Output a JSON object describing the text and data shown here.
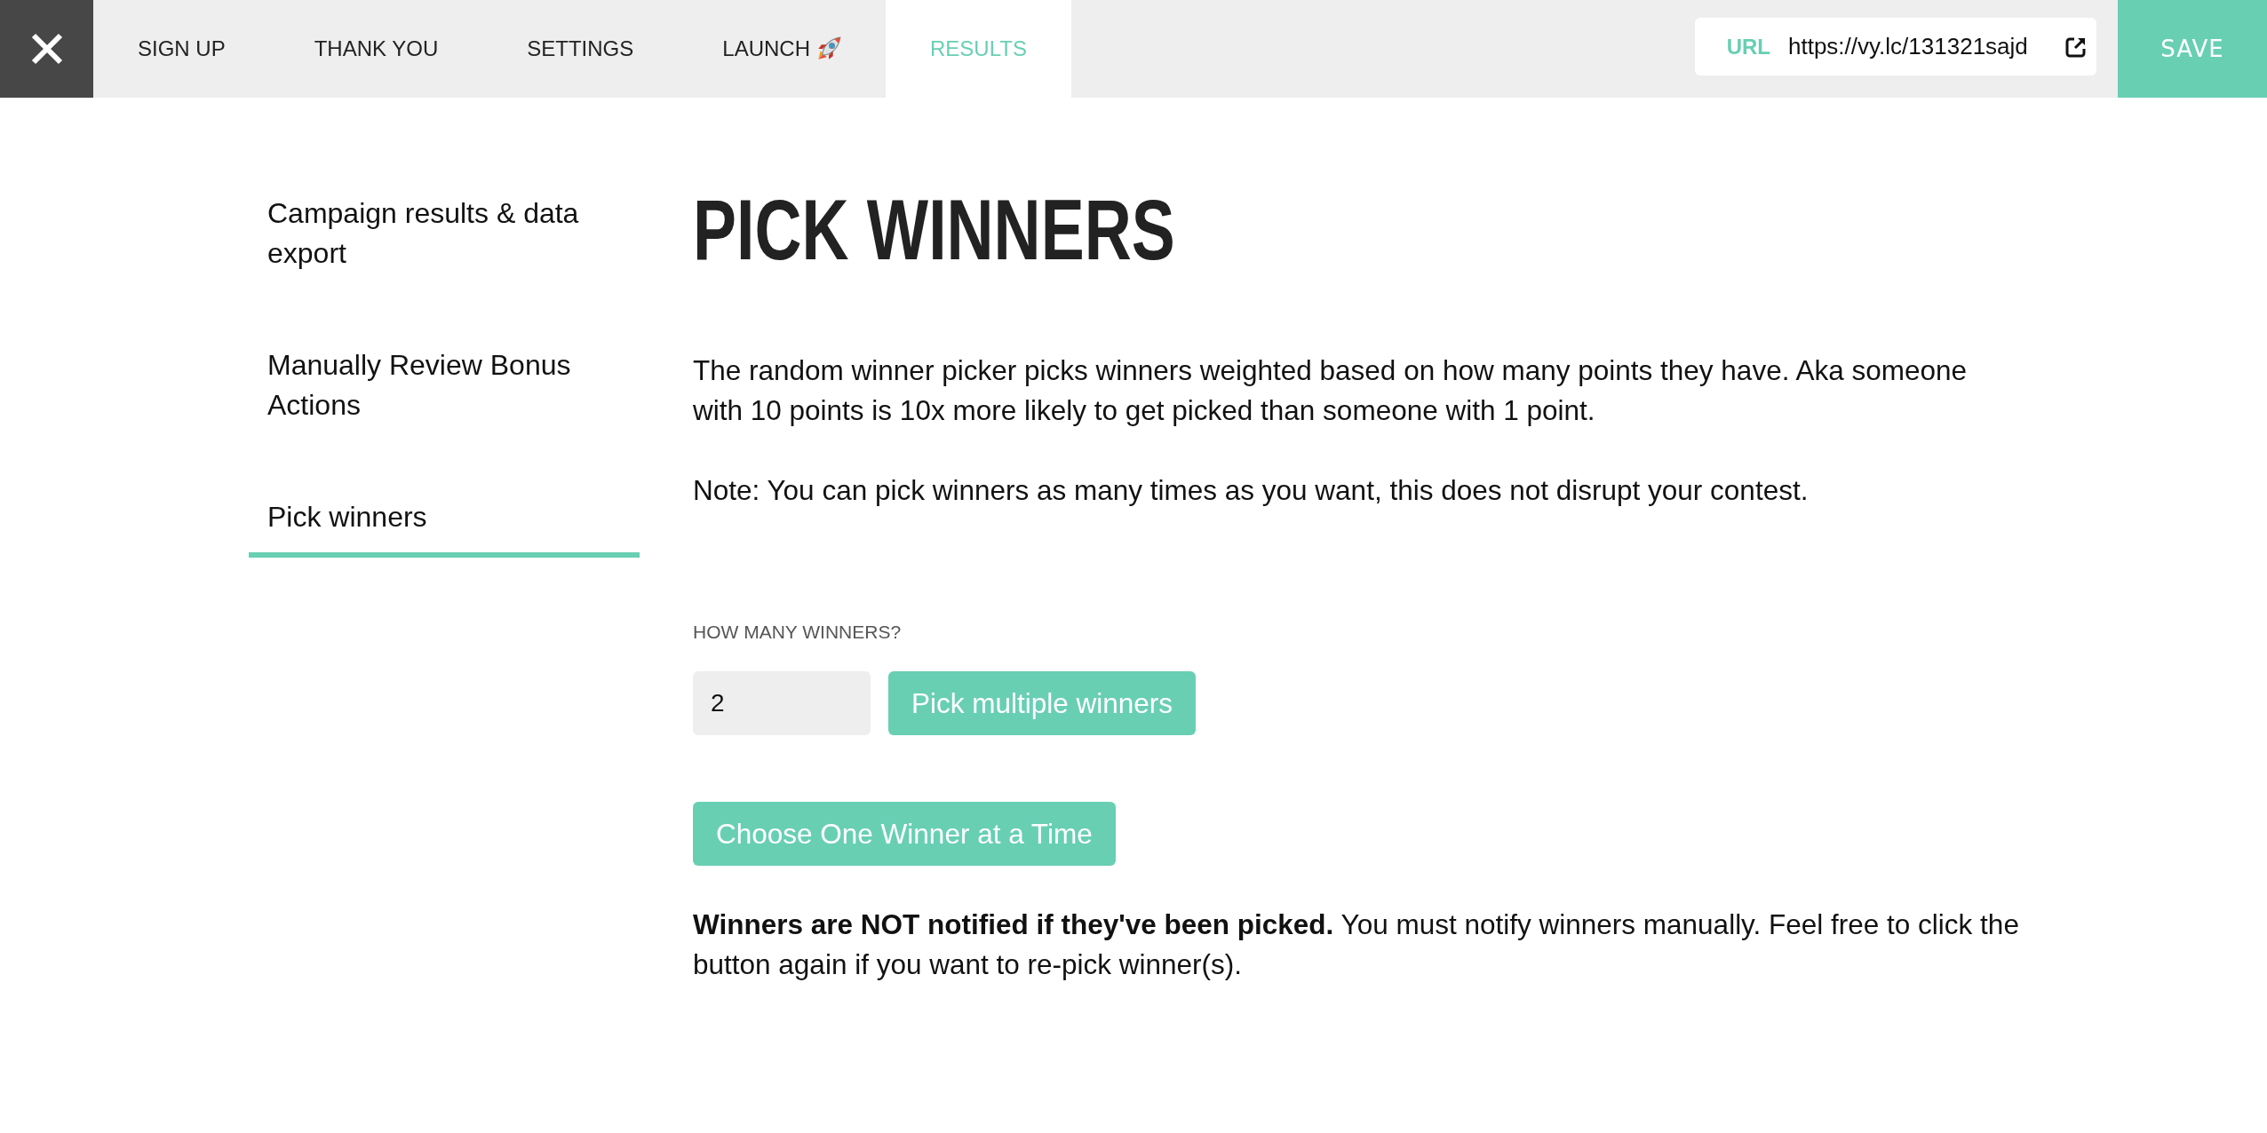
{
  "tabs": [
    {
      "label": "SIGN UP",
      "kind": "label",
      "selected": false
    },
    {
      "label": "THANK YOU",
      "kind": "label",
      "selected": false
    },
    {
      "label": "SETTINGS",
      "kind": "label",
      "selected": false
    },
    {
      "label": "LAUNCH",
      "kind": "label-emoji",
      "selected": false
    },
    {
      "label": "RESULTS",
      "kind": "label",
      "selected": true
    }
  ],
  "url_bar": {
    "label": "URL",
    "value": "https://vy.lc/131321sajd"
  },
  "save_button": "SAVE",
  "sidebar": {
    "items": [
      {
        "label": "Campaign results & data export",
        "selected": false
      },
      {
        "label": "Manually Review Bonus Actions",
        "selected": false
      },
      {
        "label": "Pick winners",
        "selected": true
      }
    ]
  },
  "main": {
    "title": "PICK WINNERS",
    "paragraphs": [
      "The random winner picker picks winners weighted based on how many points they have. Aka someone with 10 points is 10x more likely to get picked than someone with 1 point.",
      "Note: You can pick winners as many times as you want, this does not disrupt your contest."
    ],
    "winners_field": {
      "label": "HOW MANY WINNERS?",
      "value": "2"
    },
    "pick_multiple_button": "Pick multiple winners",
    "choose_one_button": "Choose One Winner at a Time",
    "notice": "**Winners are NOT notified if they've been picked.** You must notify winners manually. Feel free to click the button again if you want to re-pick winner(s)."
  }
}
